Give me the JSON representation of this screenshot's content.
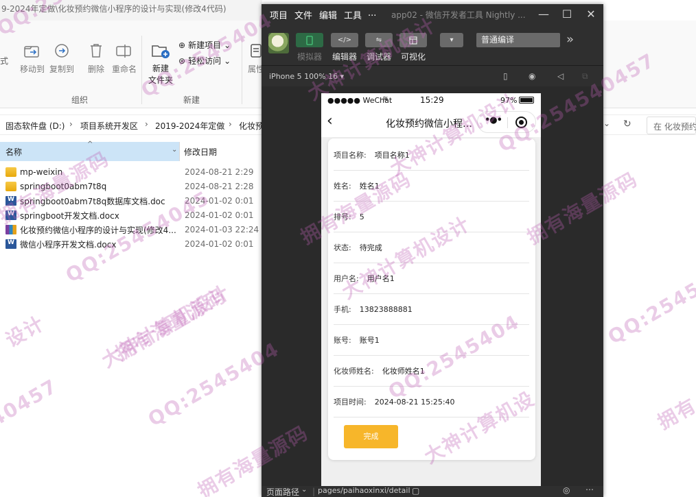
{
  "explorer": {
    "title": "9-2024年定做\\化妆预约微信小程序的设计与实现(修改4代码)",
    "ribbon": {
      "partial_left_label": "式",
      "move_to": "移动到",
      "copy_to": "复制到",
      "delete": "删除",
      "rename": "重命名",
      "organize_group": "组织",
      "new_folder": "新建\n文件夹",
      "new_item": "新建项目",
      "easy_access": "轻松访问",
      "new_group": "新建",
      "properties": "属性"
    },
    "breadcrumb": [
      "固态软件盘 (D:)",
      "项目系统开发区",
      "2019-2024年定做",
      "化妆预"
    ],
    "search_placeholder": "在 化妆预约",
    "columns": {
      "name": "名称",
      "date": "修改日期"
    },
    "files": [
      {
        "name": "mp-weixin",
        "date": "2024-08-21 2:29",
        "type": "folder"
      },
      {
        "name": "springboot0abm7t8q",
        "date": "2024-08-21 2:28",
        "type": "folder"
      },
      {
        "name": "springboot0abm7t8q数据库文档.doc",
        "date": "2024-01-02 0:01",
        "type": "doc"
      },
      {
        "name": "springboot开发文档.docx",
        "date": "2024-01-02 0:01",
        "type": "doc"
      },
      {
        "name": "化妆预约微信小程序的设计与实现(修改4...",
        "date": "2024-01-03 22:24",
        "type": "archive"
      },
      {
        "name": "微信小程序开发文档.docx",
        "date": "2024-01-02 0:01",
        "type": "doc"
      }
    ]
  },
  "devtools": {
    "menu": [
      "项目",
      "文件",
      "编辑",
      "工具",
      "..."
    ],
    "title": "app02 - 微信开发者工具 Nightly ...",
    "toolbar": {
      "simulator": "模拟器",
      "editor": "编辑器",
      "debugger": "调试器",
      "visualize": "可视化",
      "compile_mode": "普通编译"
    },
    "device": "iPhone 5 100% 16 ▾",
    "status": {
      "path_label": "页面路径",
      "path": "pages/paihaoxinxi/detail"
    }
  },
  "phone": {
    "carrier": "●●●●● WeChat",
    "time": "15:29",
    "battery": "97%",
    "nav_title": "化妆预约微信小程序...",
    "rows": [
      {
        "label": "项目名称:",
        "value": "项目名称1"
      },
      {
        "label": "姓名:",
        "value": "姓名1"
      },
      {
        "label": "排号:",
        "value": "5"
      },
      {
        "label": "状态:",
        "value": "待完成"
      },
      {
        "label": "用户名:",
        "value": "用户名1"
      },
      {
        "label": "手机:",
        "value": "13823888881"
      },
      {
        "label": "账号:",
        "value": "账号1"
      },
      {
        "label": "化妆师姓名:",
        "value": "化妆师姓名1"
      },
      {
        "label": "项目时间:",
        "value": "2024-08-21 15:25:40"
      }
    ],
    "done_button": "完成"
  },
  "watermarks": [
    "QQ:2545404",
    "拥有海量源码",
    "大神计算机设计",
    "QQ:25454045",
    "拥有海量源码",
    "QQ:2545404",
    "设计",
    "QQ:2545404",
    "大神计算机设计",
    "拥有海量源码",
    "QQ:2545404",
    "大神计算机设",
    "QQ:25454",
    "40457",
    "拥有",
    "大神计算机设计",
    "拥有海量源码",
    "QQ:254540457",
    "拥有海量源码",
    "大神计算机设计"
  ],
  "colors": {
    "accent_button": "#f7b62a",
    "selected_column": "#cce4f7",
    "devtools_bg": "#2c2c2c",
    "watermark": "#be5fb4"
  }
}
